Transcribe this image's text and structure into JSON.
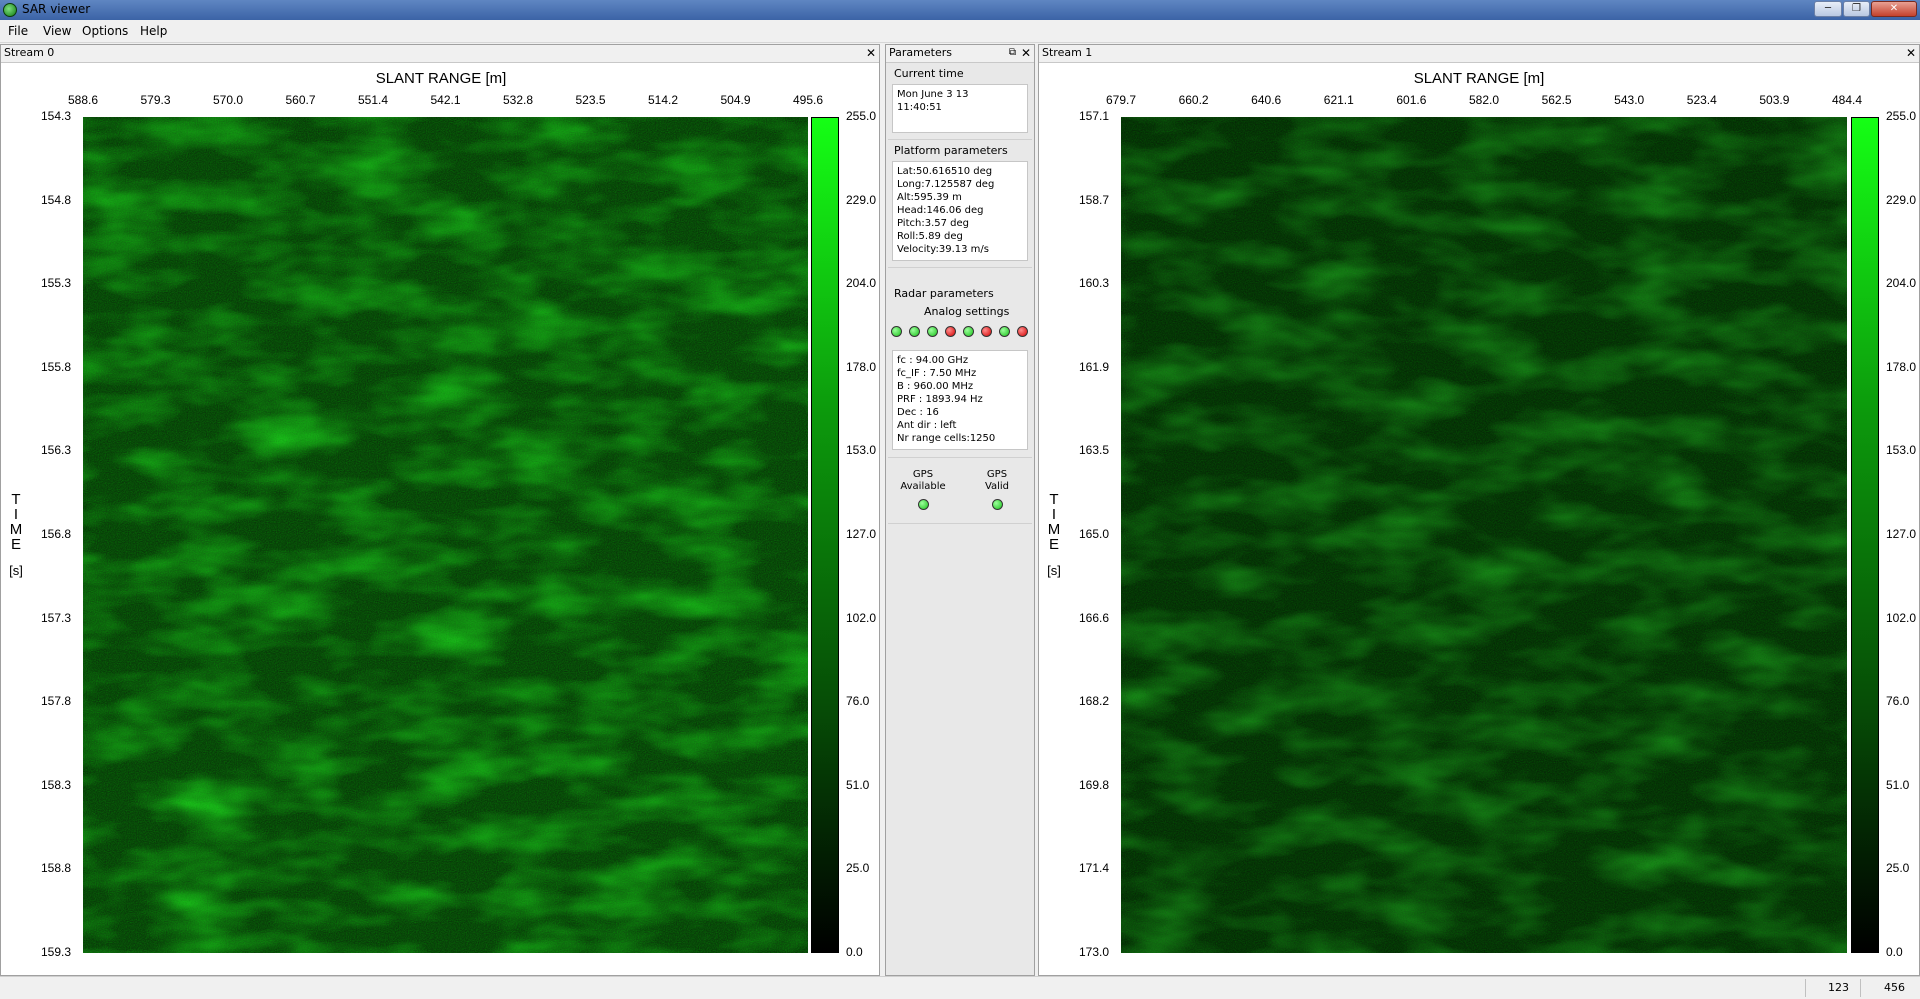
{
  "window": {
    "title": "SAR viewer"
  },
  "menu": [
    "File",
    "View",
    "Options",
    "Help"
  ],
  "streams": [
    {
      "title": "Stream 0",
      "x_axis_label": "SLANT RANGE [m]",
      "x_ticks": [
        "588.6",
        "579.3",
        "570.0",
        "560.7",
        "551.4",
        "542.1",
        "532.8",
        "523.5",
        "514.2",
        "504.9",
        "495.6"
      ],
      "y_axis_label_letters": [
        "T",
        "I",
        "M",
        "E"
      ],
      "y_axis_unit": "[s]",
      "y_ticks": [
        "154.3",
        "154.8",
        "155.3",
        "155.8",
        "156.3",
        "156.8",
        "157.3",
        "157.8",
        "158.3",
        "158.8",
        "159.3"
      ],
      "colorbar_ticks": [
        "255.0",
        "229.0",
        "204.0",
        "178.0",
        "153.0",
        "127.0",
        "102.0",
        "76.0",
        "51.0",
        "25.0",
        "0.0"
      ],
      "image_tint": "#1a7a1a"
    },
    {
      "title": "Stream 1",
      "x_axis_label": "SLANT RANGE [m]",
      "x_ticks": [
        "679.7",
        "660.2",
        "640.6",
        "621.1",
        "601.6",
        "582.0",
        "562.5",
        "543.0",
        "523.4",
        "503.9",
        "484.4"
      ],
      "y_axis_label_letters": [
        "T",
        "I",
        "M",
        "E"
      ],
      "y_axis_unit": "[s]",
      "y_ticks": [
        "157.1",
        "158.7",
        "160.3",
        "161.9",
        "163.5",
        "165.0",
        "166.6",
        "168.2",
        "169.8",
        "171.4",
        "173.0"
      ],
      "colorbar_ticks": [
        "255.0",
        "229.0",
        "204.0",
        "178.0",
        "153.0",
        "127.0",
        "102.0",
        "76.0",
        "51.0",
        "25.0",
        "0.0"
      ],
      "image_tint": "#0f4a0f"
    }
  ],
  "parameters": {
    "title": "Parameters",
    "current_time_title": "Current time",
    "current_time": [
      "Mon June 3 13",
      "11:40:51"
    ],
    "platform_title": "Platform parameters",
    "platform": [
      "Lat:50.616510 deg",
      "Long:7.125587 deg",
      "Alt:595.39 m",
      "Head:146.06 deg",
      "Pitch:3.57 deg",
      "Roll:5.89 deg",
      "Velocity:39.13 m/s"
    ],
    "radar_title": "Radar parameters",
    "analog_title": "Analog settings",
    "analog_leds": [
      "green",
      "green",
      "green",
      "red",
      "green",
      "red",
      "green",
      "red"
    ],
    "radar": [
      "fc : 94.00 GHz",
      "fc_IF : 7.50 MHz",
      "B : 960.00 MHz",
      "PRF : 1893.94 Hz",
      "Dec : 16",
      "Ant dir : left",
      "Nr range cells:1250"
    ],
    "gps": [
      {
        "label_1": "GPS",
        "label_2": "Available",
        "status": "green"
      },
      {
        "label_1": "GPS",
        "label_2": "Valid",
        "status": "green"
      }
    ]
  },
  "status": {
    "cell_1": "123",
    "cell_2": "456"
  },
  "colors": {
    "led_green": "#19c019",
    "led_red": "#d40000",
    "colorbar_top": "#15ff15"
  }
}
